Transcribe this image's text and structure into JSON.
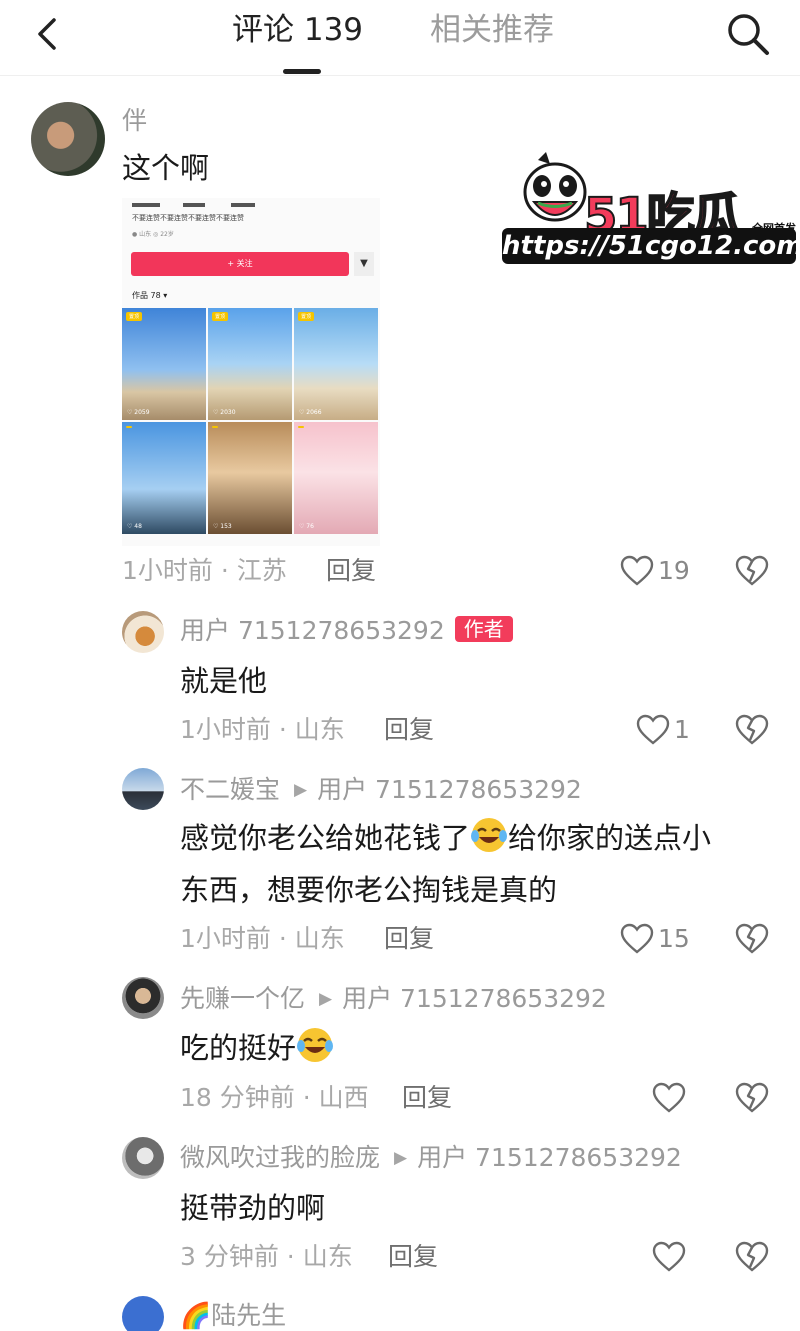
{
  "header": {
    "tab_comments": "评论 139",
    "tab_related": "相关推荐"
  },
  "watermark": {
    "logo": "51吃瓜",
    "tag": "全网首发",
    "url": "https://51cgo12.com"
  },
  "screenshot": {
    "follow_label": "+ 关注",
    "works_label": "作品 78 ▾",
    "intro_line": "不要连赞不要连赞不要连赞不要连赞",
    "tags": "● 山东   ◎ 22岁",
    "cells": [
      {
        "pin": "置顶",
        "count": "♡ 2059"
      },
      {
        "pin": "置顶",
        "count": "♡ 2030"
      },
      {
        "pin": "置顶",
        "count": "♡ 2066"
      },
      {
        "pin": "",
        "count": "♡ 48"
      },
      {
        "pin": "",
        "count": "♡ 153"
      },
      {
        "pin": "",
        "count": "♡ 76"
      }
    ]
  },
  "comments": [
    {
      "user": "伴",
      "text": "这个啊",
      "time_location": "1小时前 · 江苏",
      "reply_label": "回复",
      "likes": "19"
    },
    {
      "user": "用户 7151278653292",
      "badge": "作者",
      "text": "就是他",
      "time_location": "1小时前 · 山东",
      "reply_label": "回复",
      "likes": "1"
    },
    {
      "user": "不二媛宝",
      "reply_to": "用户 7151278653292",
      "text_part1": "感觉你老公给她花钱了",
      "text_part2": "给你家的送点小",
      "text_line2": "东西，想要你老公掏钱是真的",
      "time_location": "1小时前 · 山东",
      "reply_label": "回复",
      "likes": "15"
    },
    {
      "user": "先赚一个亿",
      "reply_to": "用户 7151278653292",
      "text": "吃的挺好",
      "time_location": "18 分钟前 · 山西",
      "reply_label": "回复",
      "likes": ""
    },
    {
      "user": "微风吹过我的脸庞",
      "reply_to": "用户 7151278653292",
      "text": "挺带劲的啊",
      "time_location": "3 分钟前 · 山东",
      "reply_label": "回复",
      "likes": ""
    },
    {
      "user": "🌈陆先生"
    }
  ],
  "colors": {
    "accent": "#f23c5b",
    "meta_gray": "#a8a8a8"
  }
}
